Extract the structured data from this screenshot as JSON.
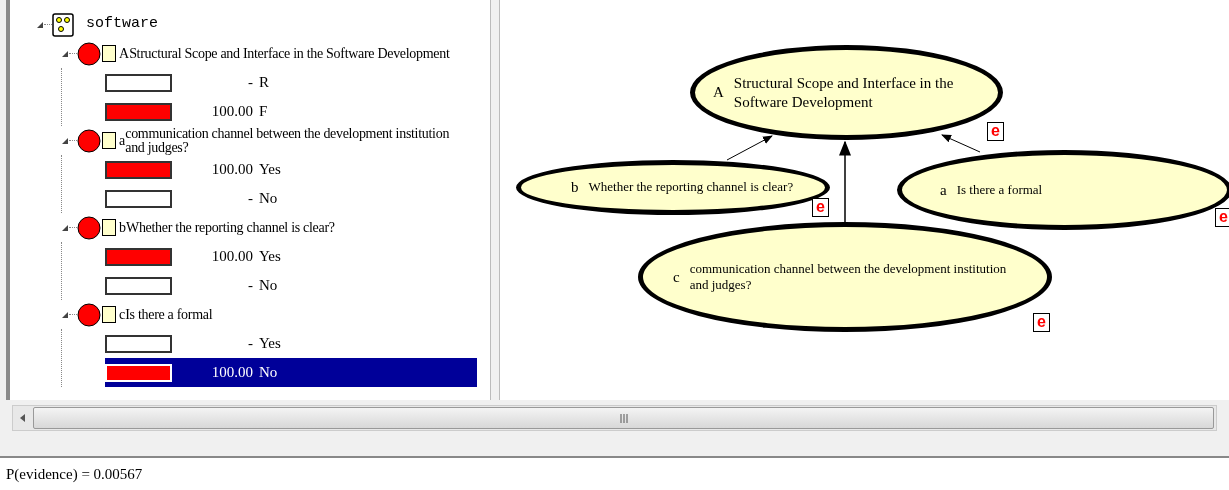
{
  "tree": {
    "root": {
      "label": "software",
      "expanded": true
    },
    "nodes": [
      {
        "letter": "A",
        "label": "Structural Scope and Interface in the Software Development",
        "expanded": true,
        "states": [
          {
            "value": "-",
            "name": "R",
            "level": 0,
            "selected": false
          },
          {
            "value": "100.00",
            "name": "F",
            "level": 1,
            "selected": false
          }
        ]
      },
      {
        "letter": "a",
        "label": "communication channel between the development institution and judges?",
        "expanded": true,
        "states": [
          {
            "value": "100.00",
            "name": "Yes",
            "level": 1,
            "selected": false
          },
          {
            "value": "-",
            "name": "No",
            "level": 0,
            "selected": false
          }
        ]
      },
      {
        "letter": "b",
        "label": "Whether the reporting channel is clear?",
        "expanded": true,
        "states": [
          {
            "value": "100.00",
            "name": "Yes",
            "level": 1,
            "selected": false
          },
          {
            "value": "-",
            "name": "No",
            "level": 0,
            "selected": false
          }
        ]
      },
      {
        "letter": "c",
        "label": "Is there a formal",
        "expanded": true,
        "states": [
          {
            "value": "-",
            "name": "Yes",
            "level": 0,
            "selected": false
          },
          {
            "value": "100.00",
            "name": "No",
            "level": 1,
            "selected": true
          }
        ]
      }
    ]
  },
  "graph": {
    "nodes": [
      {
        "letter": "A",
        "label": "Structural Scope and Interface in the Software Development",
        "badge": "e"
      },
      {
        "letter": "b",
        "label": "Whether the reporting channel is clear?",
        "badge": "e"
      },
      {
        "letter": "a",
        "label": "Is there a formal",
        "badge": "e"
      },
      {
        "letter": "c",
        "label": "communication channel between the development institution and judges?",
        "badge": "e"
      }
    ]
  },
  "status_bar": {
    "text": "P(evidence) = 0.00567"
  }
}
